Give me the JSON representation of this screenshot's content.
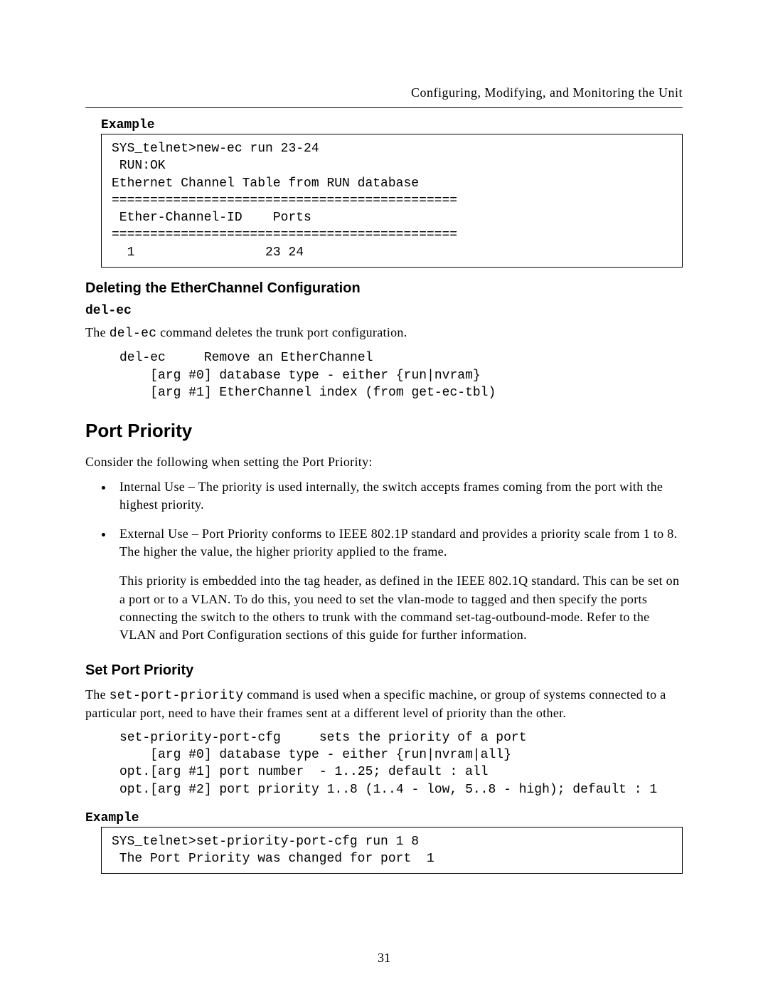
{
  "header": {
    "running_title": "Configuring, Modifying, and Monitoring the Unit"
  },
  "example1": {
    "label": "Example",
    "code": "SYS_telnet>new-ec run 23-24\n RUN:OK\nEthernet Channel Table from RUN database\n=============================================\n Ether-Channel-ID    Ports\n=============================================\n  1                 23 24"
  },
  "deleting": {
    "heading": "Deleting the EtherChannel Configuration",
    "command": "del-ec",
    "desc_prefix": "The ",
    "desc_cmd": "del-ec",
    "desc_suffix": " command deletes the trunk port configuration.",
    "syntax": "del-ec     Remove an EtherChannel\n    [arg #0] database type - either {run|nvram}\n    [arg #1] EtherChannel index (from get-ec-tbl)"
  },
  "port_priority": {
    "heading": "Port Priority",
    "intro": "Consider the following when setting the Port Priority:",
    "bullets": [
      "Internal Use – The priority is used internally, the switch accepts frames coming from the port with the highest priority.",
      "External Use – Port Priority conforms to IEEE 802.1P standard and provides a priority scale from 1 to 8.  The higher the value, the higher priority applied to the frame."
    ],
    "extra_para": "This priority is embedded into the tag header, as defined in the IEEE 802.1Q standard.  This can be set on a port or to a VLAN.  To do this, you need to set the vlan-mode to tagged and then specify the ports connecting the switch to the others to trunk with the command set-tag-outbound-mode.  Refer to the VLAN and Port Configuration sections of this guide for further information."
  },
  "set_port_priority": {
    "heading": "Set Port Priority",
    "desc_prefix": "The ",
    "desc_cmd": "set-port-priority",
    "desc_suffix": " command is used when a specific machine, or group of systems connected to a particular port, need to have their frames sent at a different level of priority than the other.",
    "syntax": "set-priority-port-cfg     sets the priority of a port\n    [arg #0] database type - either {run|nvram|all}\nopt.[arg #1] port number  - 1..25; default : all\nopt.[arg #2] port priority 1..8 (1..4 - low, 5..8 - high); default : 1"
  },
  "example2": {
    "label": "Example",
    "code": "SYS_telnet>set-priority-port-cfg run 1 8\n The Port Priority was changed for port  1"
  },
  "footer": {
    "page_number": "31"
  }
}
